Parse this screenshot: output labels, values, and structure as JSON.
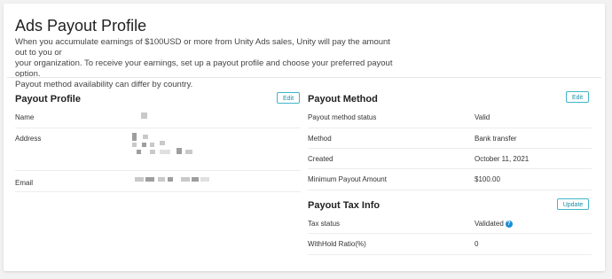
{
  "header": {
    "title": "Ads Payout Profile",
    "description_lines": [
      "When you accumulate earnings of $100USD or more from Unity Ads sales, Unity will pay the amount out to you or",
      "your organization. To receive your earnings, set up a payout profile and choose your preferred payout option.",
      "Payout method availability can differ by country."
    ]
  },
  "payout_profile": {
    "title": "Payout Profile",
    "edit_label": "Edit",
    "rows": [
      {
        "label": "Name"
      },
      {
        "label": "Address"
      },
      {
        "label": "Email"
      }
    ]
  },
  "payout_method": {
    "title": "Payout Method",
    "edit_label": "Edit",
    "rows": [
      {
        "label": "Payout method status",
        "value": "Valid"
      },
      {
        "label": "Method",
        "value": "Bank transfer"
      },
      {
        "label": "Created",
        "value": "October 11, 2021"
      },
      {
        "label": "Minimum Payout Amount",
        "value": "$100.00"
      }
    ]
  },
  "payout_tax_info": {
    "title": "Payout Tax Info",
    "update_label": "Update",
    "rows": [
      {
        "label": "Tax status",
        "value": "Validated"
      },
      {
        "label": "WithHold Ratio(%)",
        "value": "0"
      }
    ]
  },
  "colors": {
    "accent": "#3fb6c9",
    "help_icon": "#1a8fd6"
  },
  "icons": {
    "tax_status_help": "question-circle-icon"
  }
}
